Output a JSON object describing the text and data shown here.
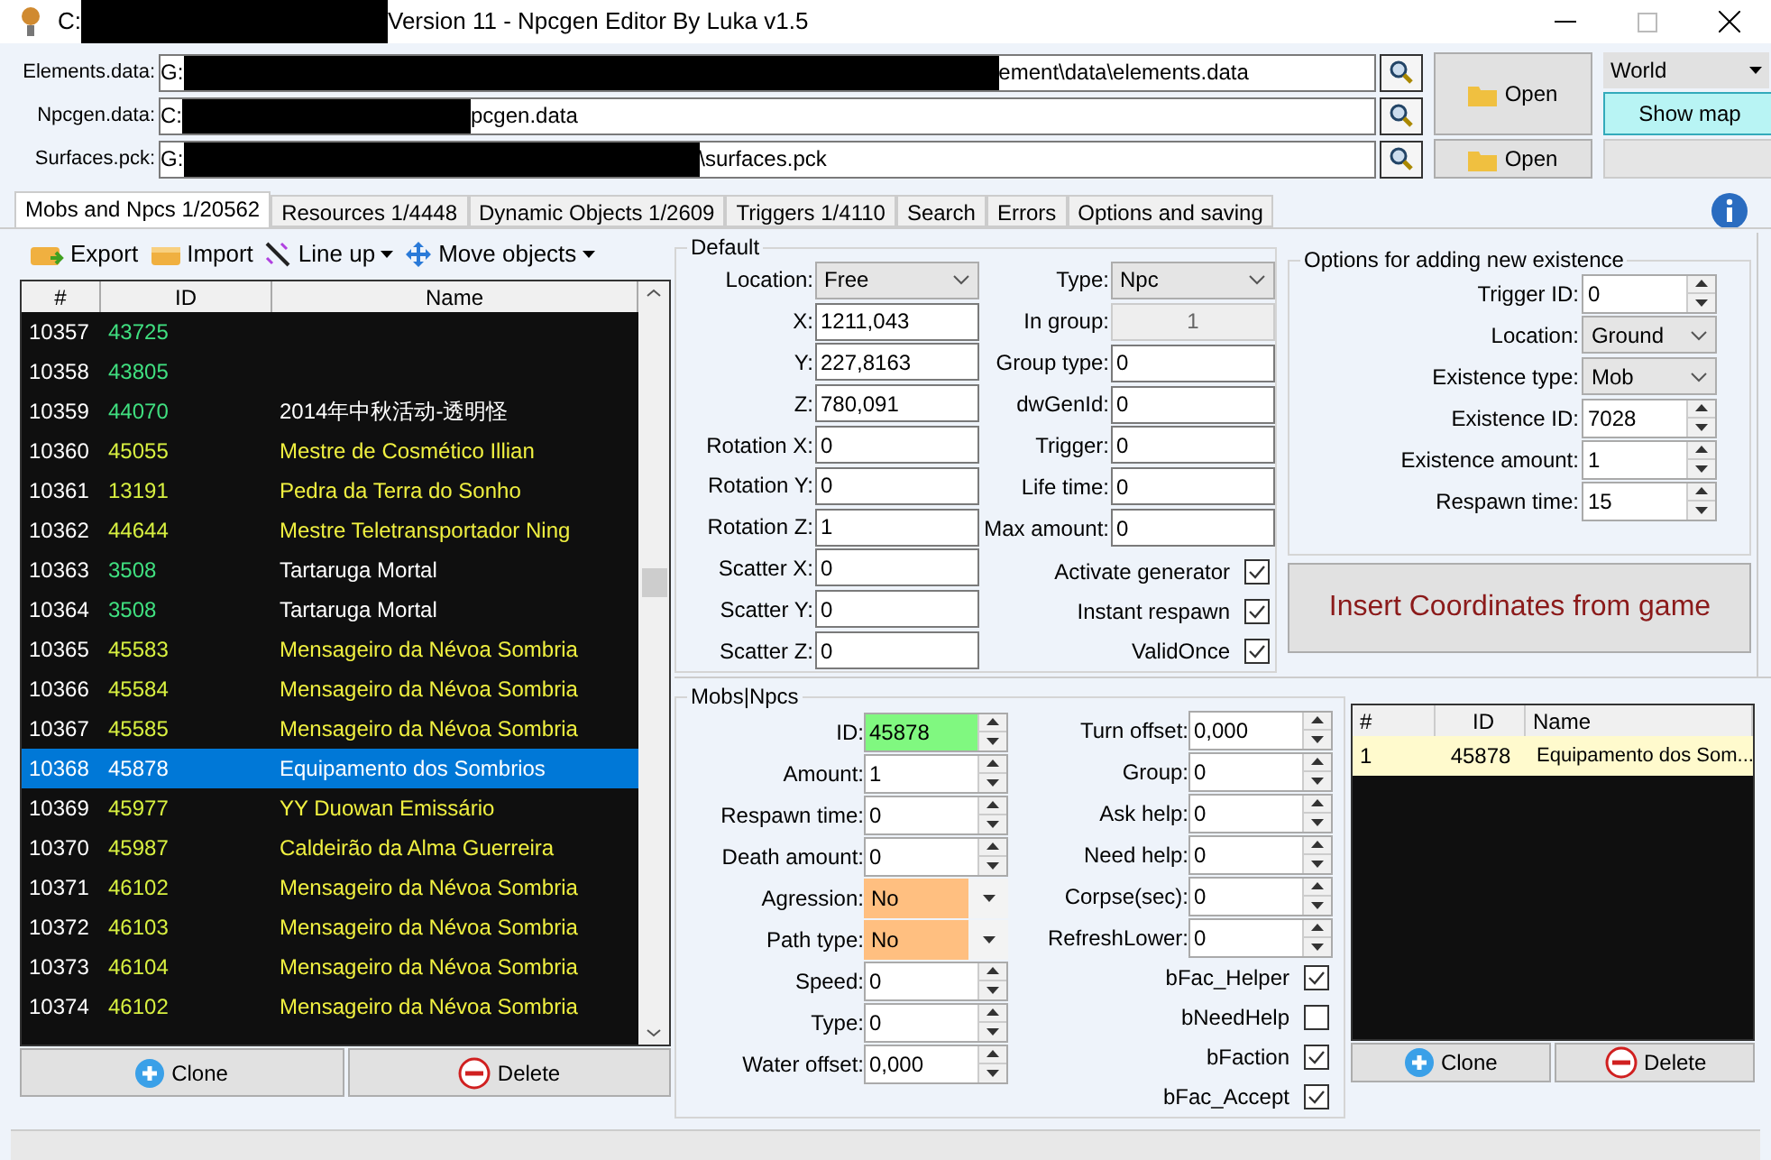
{
  "window": {
    "title_prefix": "C:",
    "title": "Version 11  -  Npcgen Editor By Luka v1.5"
  },
  "paths": [
    {
      "label": "Elements.data:",
      "prefix": "G:",
      "suffix": "ement\\data\\elements.data"
    },
    {
      "label": "Npcgen.data:",
      "prefix": "C:",
      "suffix": "pcgen.data"
    },
    {
      "label": "Surfaces.pck:",
      "prefix": "G:",
      "suffix": "\\surfaces.pck"
    }
  ],
  "open_buttons": [
    "Open",
    "Open"
  ],
  "world_select": "World",
  "show_map": "Show map",
  "tabs": [
    {
      "label": "Mobs and Npcs 1/20562",
      "selected": true
    },
    {
      "label": "Resources 1/4448",
      "selected": false
    },
    {
      "label": "Dynamic Objects 1/2609",
      "selected": false
    },
    {
      "label": "Triggers 1/4110",
      "selected": false
    },
    {
      "label": "Search",
      "selected": false
    },
    {
      "label": "Errors",
      "selected": false
    },
    {
      "label": "Options and saving",
      "selected": false
    }
  ],
  "toolbar": [
    {
      "label": "Export",
      "kind": "export",
      "dropdown": false
    },
    {
      "label": "Import",
      "kind": "import",
      "dropdown": false
    },
    {
      "label": "Line up",
      "kind": "lineup",
      "dropdown": true
    },
    {
      "label": "Move objects",
      "kind": "move",
      "dropdown": true
    }
  ],
  "list": {
    "columns": [
      "#",
      "ID",
      "Name"
    ],
    "rows": [
      {
        "num": "10357",
        "id": "43725",
        "kind": "mob",
        "selected": false
      },
      {
        "num": "10358",
        "id": "43805",
        "kind": "mob",
        "selected": false
      },
      {
        "num": "10359",
        "id": "44070",
        "name": "2014年中秋活动-透明怪",
        "kind": "mob",
        "selected": false
      },
      {
        "num": "10360",
        "id": "45055",
        "name": "Mestre de Cosmético Illian",
        "kind": "npc",
        "selected": false
      },
      {
        "num": "10361",
        "id": "13191",
        "name": "Pedra da Terra do Sonho",
        "kind": "npc",
        "selected": false
      },
      {
        "num": "10362",
        "id": "44644",
        "name": "Mestre Teletransportador Ning",
        "kind": "npc",
        "selected": false
      },
      {
        "num": "10363",
        "id": "3508",
        "name": "Tartaruga Mortal",
        "kind": "mob",
        "selected": false
      },
      {
        "num": "10364",
        "id": "3508",
        "name": "Tartaruga Mortal",
        "kind": "mob",
        "selected": false
      },
      {
        "num": "10365",
        "id": "45583",
        "name": "Mensageiro da Névoa Sombria",
        "kind": "npc",
        "selected": false
      },
      {
        "num": "10366",
        "id": "45584",
        "name": "Mensageiro da Névoa Sombria",
        "kind": "npc",
        "selected": false
      },
      {
        "num": "10367",
        "id": "45585",
        "name": "Mensageiro da Névoa Sombria",
        "kind": "npc",
        "selected": false
      },
      {
        "num": "10368",
        "id": "45878",
        "name": "Equipamento dos Sombrios",
        "kind": "npc",
        "selected": true
      },
      {
        "num": "10369",
        "id": "45977",
        "name": "YY Duowan Emissário",
        "kind": "npc",
        "selected": false
      },
      {
        "num": "10370",
        "id": "45987",
        "name": "Caldeirão da Alma Guerreira",
        "kind": "npc",
        "selected": false
      },
      {
        "num": "10371",
        "id": "46102",
        "name": "Mensageiro da Névoa Sombria",
        "kind": "npc",
        "selected": false
      },
      {
        "num": "10372",
        "id": "46103",
        "name": "Mensageiro da Névoa Sombria",
        "kind": "npc",
        "selected": false
      },
      {
        "num": "10373",
        "id": "46104",
        "name": "Mensageiro da Névoa Sombria",
        "kind": "npc",
        "selected": false
      },
      {
        "num": "10374",
        "id": "46102",
        "name": "Mensageiro da Névoa Sombria",
        "kind": "npc",
        "selected": false
      }
    ]
  },
  "list_buttons": [
    {
      "label": "Clone",
      "kind": "add"
    },
    {
      "label": "Delete",
      "kind": "remove"
    }
  ],
  "default": {
    "title": "Default",
    "left_fields": [
      {
        "label": "Location:",
        "value": "Free",
        "kind": "combo"
      },
      {
        "label": "X:",
        "value": "1211,043",
        "kind": "text"
      },
      {
        "label": "Y:",
        "value": "227,8163",
        "kind": "text"
      },
      {
        "label": "Z:",
        "value": "780,091",
        "kind": "text"
      },
      {
        "label": "Rotation X:",
        "value": "0",
        "kind": "text"
      },
      {
        "label": "Rotation Y:",
        "value": "0",
        "kind": "text"
      },
      {
        "label": "Rotation Z:",
        "value": "1",
        "kind": "text"
      },
      {
        "label": "Scatter X:",
        "value": "0",
        "kind": "text"
      },
      {
        "label": "Scatter Y:",
        "value": "0",
        "kind": "text"
      },
      {
        "label": "Scatter Z:",
        "value": "0",
        "kind": "text"
      }
    ],
    "right_fields": [
      {
        "label": "Type:",
        "value": "Npc",
        "kind": "combo"
      },
      {
        "label": "In group:",
        "value": "1",
        "kind": "readonly"
      },
      {
        "label": "Group type:",
        "value": "0",
        "kind": "text"
      },
      {
        "label": "dwGenId:",
        "value": "0",
        "kind": "text"
      },
      {
        "label": "Trigger:",
        "value": "0",
        "kind": "text"
      },
      {
        "label": "Life time:",
        "value": "0",
        "kind": "text"
      },
      {
        "label": "Max amount:",
        "value": "0",
        "kind": "text"
      }
    ],
    "checks": [
      {
        "label": "Activate generator",
        "checked": true
      },
      {
        "label": "Instant respawn",
        "checked": true
      },
      {
        "label": "ValidOnce",
        "checked": true
      }
    ]
  },
  "options": {
    "title": "Options for adding new existence",
    "fields": [
      {
        "label": "Trigger ID:",
        "value": "0",
        "kind": "spin"
      },
      {
        "label": "Location:",
        "value": "Ground",
        "kind": "combo"
      },
      {
        "label": "Existence type:",
        "value": "Mob",
        "kind": "combo"
      },
      {
        "label": "Existence ID:",
        "value": "7028",
        "kind": "spin"
      },
      {
        "label": "Existence amount:",
        "value": "1",
        "kind": "spin"
      },
      {
        "label": "Respawn time:",
        "value": "15",
        "kind": "spin"
      }
    ]
  },
  "insert_button": "Insert Coordinates from game",
  "mobs": {
    "title": "Mobs|Npcs",
    "left_fields": [
      {
        "label": "ID:",
        "value": "45878",
        "kind": "spin",
        "color": "#80f880"
      },
      {
        "label": "Amount:",
        "value": "1",
        "kind": "spin"
      },
      {
        "label": "Respawn time:",
        "value": "0",
        "kind": "spin"
      },
      {
        "label": "Death amount:",
        "value": "0",
        "kind": "spin"
      },
      {
        "label": "Agression:",
        "value": "No",
        "kind": "dropdown",
        "color": "#ffbf80"
      },
      {
        "label": "Path type:",
        "value": "No",
        "kind": "dropdown",
        "color": "#ffbf80"
      },
      {
        "label": "Speed:",
        "value": "0",
        "kind": "spin"
      },
      {
        "label": "Type:",
        "value": "0",
        "kind": "spin"
      },
      {
        "label": "Water offset:",
        "value": "0,000",
        "kind": "spin"
      }
    ],
    "right_fields": [
      {
        "label": "Turn offset:",
        "value": "0,000",
        "kind": "spin"
      },
      {
        "label": "Group:",
        "value": "0",
        "kind": "spin"
      },
      {
        "label": "Ask help:",
        "value": "0",
        "kind": "spin"
      },
      {
        "label": "Need help:",
        "value": "0",
        "kind": "spin"
      },
      {
        "label": "Corpse(sec):",
        "value": "0",
        "kind": "spin"
      },
      {
        "label": "RefreshLower:",
        "value": "0",
        "kind": "spin"
      }
    ],
    "checks": [
      {
        "label": "bFac_Helper",
        "checked": true
      },
      {
        "label": "bNeedHelp",
        "checked": false
      },
      {
        "label": "bFaction",
        "checked": true
      },
      {
        "label": "bFac_Accept",
        "checked": true
      }
    ],
    "members": {
      "columns": [
        "#",
        "ID",
        "Name"
      ],
      "rows": [
        {
          "num": "1",
          "id": "45878",
          "name": "Equipamento dos Som...",
          "selected": true
        }
      ]
    },
    "member_buttons": [
      {
        "label": "Clone",
        "kind": "add"
      },
      {
        "label": "Delete",
        "kind": "remove"
      }
    ]
  }
}
